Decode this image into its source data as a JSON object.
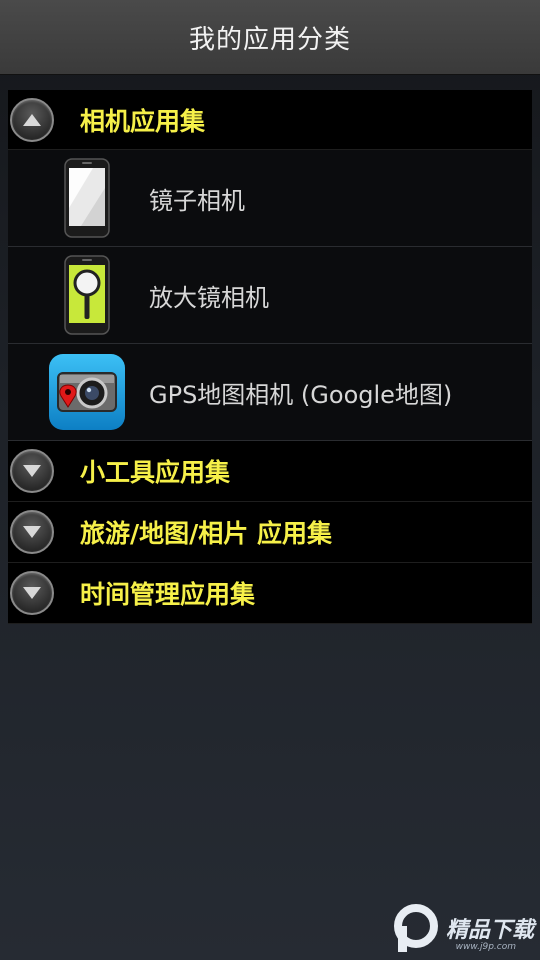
{
  "header": {
    "title": "我的应用分类"
  },
  "groups": [
    {
      "label": "相机应用集",
      "expanded": true,
      "children": [
        {
          "label": "镜子相机",
          "icon": "mirror-phone-icon"
        },
        {
          "label": "放大镜相机",
          "icon": "magnifier-phone-icon"
        },
        {
          "label": "GPS地图相机 (Google地图)",
          "icon": "gps-camera-icon"
        }
      ]
    },
    {
      "label": "小工具应用集",
      "expanded": false
    },
    {
      "label": "旅游/地图/相片 应用集",
      "expanded": false
    },
    {
      "label": "时间管理应用集",
      "expanded": false
    }
  ],
  "colors": {
    "group_label": "#f6f049",
    "child_label": "#d7d7d7",
    "title": "#f2f2f2",
    "camera_icon_blue": "#1aa0e0"
  },
  "watermark": {
    "text": "精品下载",
    "sub": "www.j9p.com"
  }
}
